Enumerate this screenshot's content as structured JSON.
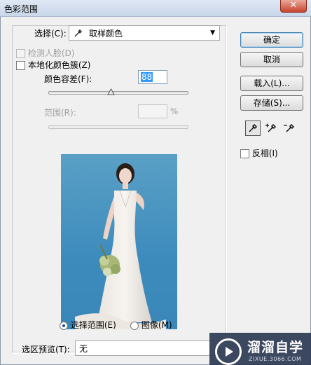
{
  "window": {
    "title": "色彩范围",
    "close_glyph": "✕"
  },
  "select_section": {
    "label": "选择(C):",
    "value": "取样颜色",
    "icon": "eyedropper-icon"
  },
  "detect_faces": {
    "label": "检测人脸(D)",
    "checked": false,
    "enabled": false
  },
  "localized_clusters": {
    "label": "本地化颜色簇(Z)",
    "checked": false
  },
  "fuzziness": {
    "label": "颜色容差(F):",
    "value": "88",
    "slider_fraction": 0.44
  },
  "range": {
    "label": "范围(R):",
    "value": "",
    "unit": "%",
    "enabled": false
  },
  "preview_mode": {
    "options": [
      {
        "label": "选择范围(E)",
        "selected": true
      },
      {
        "label": "图像(M)",
        "selected": false
      }
    ]
  },
  "selection_preview": {
    "label": "选区预览(T):",
    "value": "无"
  },
  "buttons": {
    "ok": "确定",
    "cancel": "取消",
    "load": "载入(L)...",
    "save": "存储(S)..."
  },
  "tools": [
    {
      "name": "eyedropper-icon",
      "active": true
    },
    {
      "name": "eyedropper-plus-icon",
      "active": false
    },
    {
      "name": "eyedropper-minus-icon",
      "active": false
    }
  ],
  "invert": {
    "label": "反相(I)",
    "checked": false
  },
  "watermark": {
    "main": "溜溜自学",
    "sub": "ZIXUE.3066.COM"
  },
  "colors": {
    "preview_bg": "#3d8bbd",
    "selection_highlight": "#3399ff",
    "watermark_bg": "#2c3a54"
  }
}
